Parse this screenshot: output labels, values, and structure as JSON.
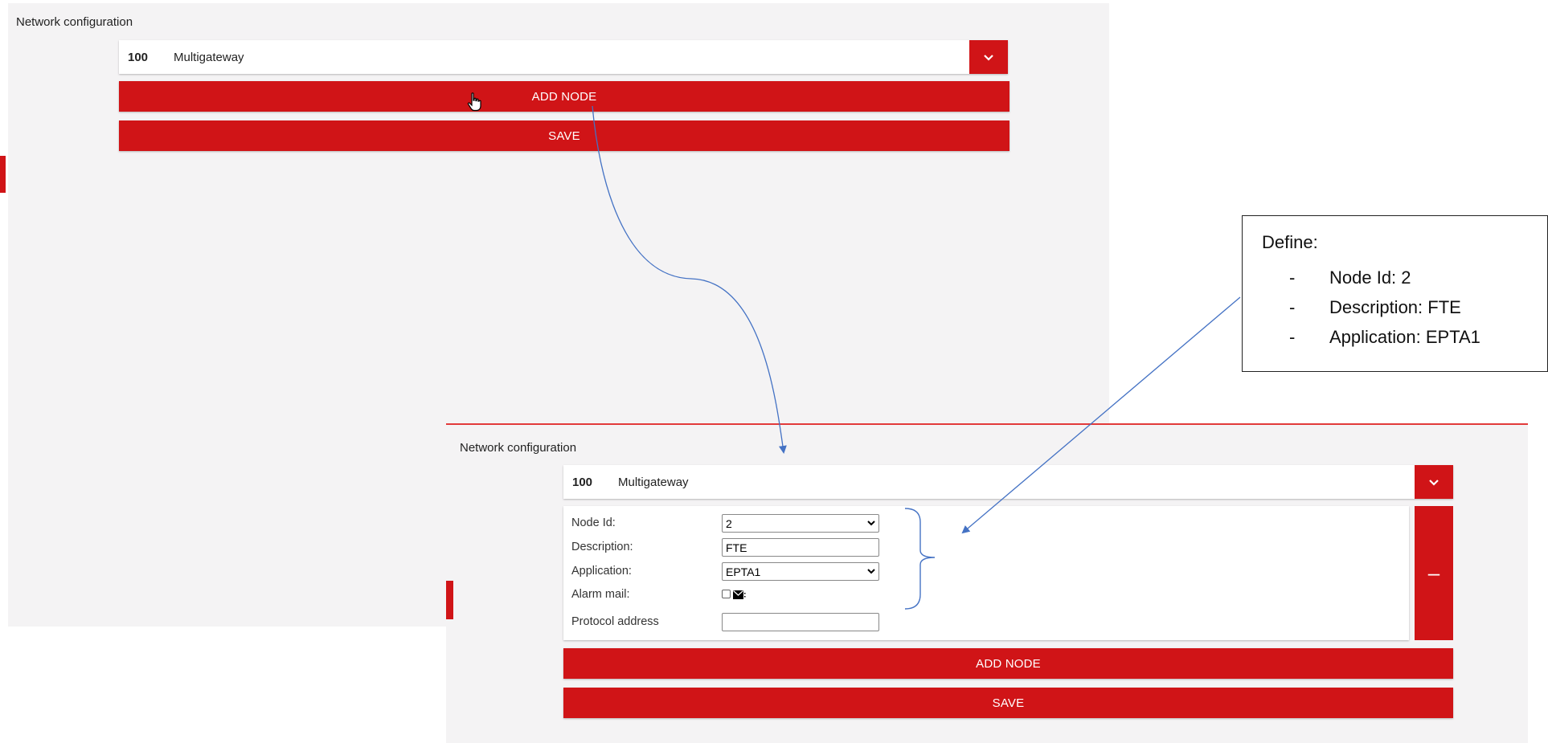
{
  "top_panel": {
    "title": "Network configuration",
    "node": {
      "id": "100",
      "name": "Multigateway"
    },
    "add_node_label": "ADD NODE",
    "save_label": "SAVE"
  },
  "bottom_panel": {
    "title": "Network configuration",
    "node": {
      "id": "100",
      "name": "Multigateway"
    },
    "form": {
      "node_id_label": "Node Id:",
      "node_id_value": "2",
      "description_label": "Description:",
      "description_value": "FTE",
      "application_label": "Application:",
      "application_value": "EPTA1",
      "alarm_mail_label": "Alarm mail:",
      "protocol_address_label": "Protocol address",
      "protocol_address_value": ""
    },
    "remove_label": "–",
    "add_node_label": "ADD NODE",
    "save_label": "SAVE"
  },
  "callout": {
    "heading": "Define:",
    "items": [
      "Node Id: 2",
      "Description: FTE",
      "Application: EPTA1"
    ]
  },
  "colors": {
    "accent_red": "#d01417",
    "arrow_blue": "#4472c4",
    "panel_bg": "#f4f3f4"
  }
}
